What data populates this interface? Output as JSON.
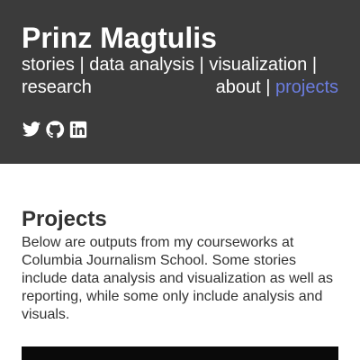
{
  "header": {
    "title": "Prinz Magtulis",
    "nav": {
      "stories": "stories",
      "data_analysis": "data analysis",
      "visualization": "visualization",
      "research": "research",
      "about": "about",
      "projects": "projects",
      "separator": "|"
    },
    "social": [
      "twitter-icon",
      "github-icon",
      "linkedin-icon"
    ],
    "active_color": "#6b7de0",
    "background": "#3b3b3b"
  },
  "main": {
    "heading": "Projects",
    "description": "Below are outputs from my courseworks at Columbia Journalism School. Some stories include data analysis and visualization as well as reporting, while some only include analysis and visuals."
  }
}
